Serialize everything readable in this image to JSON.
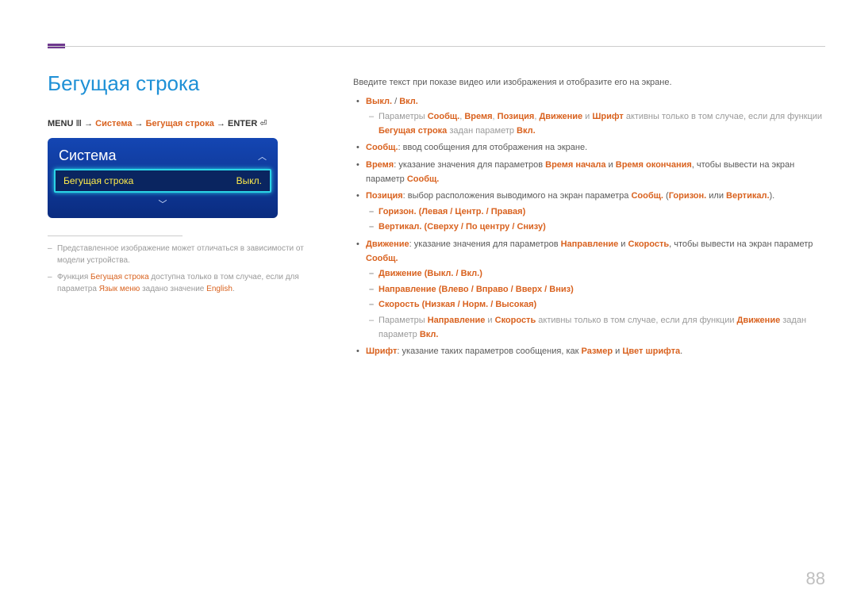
{
  "page_number": "88",
  "title": "Бегущая строка",
  "breadcrumb": {
    "menu": "MENU",
    "menu_icon": "Ⅲ",
    "arrow": "→",
    "p1": "Система",
    "p2": "Бегущая строка",
    "enter": "ENTER",
    "enter_icon": "⏎"
  },
  "osd": {
    "title": "Система",
    "up": "︿",
    "down": "﹀",
    "row_label": "Бегущая строка",
    "row_value": "Выкл."
  },
  "left_notes": {
    "n1_a": "Представленное изображение может отличаться в зависимости от модели устройства.",
    "n2_a": "Функция ",
    "n2_b": "Бегущая строка",
    "n2_c": " доступна только в том случае, если для параметра ",
    "n2_d": "Язык меню",
    "n2_e": " задано значение ",
    "n2_f": "English",
    "n2_g": "."
  },
  "right": {
    "intro": "Введите текст при показе видео или изображения и отобразите его на экране.",
    "b1_off": "Выкл.",
    "b1_sep": " / ",
    "b1_on": "Вкл.",
    "b1_sub_a": "Параметры ",
    "b1_sub_msg": "Сообщ.",
    "b1_sub_comma": ", ",
    "b1_sub_time": "Время",
    "b1_sub_pos": "Позиция",
    "b1_sub_mov": "Движение",
    "b1_sub_and": " и ",
    "b1_sub_font": "Шрифт",
    "b1_sub_b": " активны только в том случае, если для функции ",
    "b1_sub_ticker": "Бегущая строка",
    "b1_sub_c": " задан параметр ",
    "b1_sub_on": "Вкл.",
    "b2_label": "Сообщ.",
    "b2_text": ": ввод сообщения для отображения на экране.",
    "b3_label": "Время",
    "b3_text_a": ": указание значения для параметров ",
    "b3_start": "Время начала",
    "b3_text_b": " и ",
    "b3_end": "Время окончания",
    "b3_text_c": ", чтобы вывести на экран параметр ",
    "b3_msg": "Сообщ.",
    "b4_label": "Позиция",
    "b4_text_a": ": выбор расположения выводимого на экран параметра ",
    "b4_msg": "Сообщ.",
    "b4_text_b": " (",
    "b4_hor": "Горизон.",
    "b4_text_c": " или ",
    "b4_ver": "Вертикал.",
    "b4_text_d": ").",
    "b4_s1_a": "Горизон.",
    "b4_s1_b": " (",
    "b4_s1_c": "Левая",
    "b4_s1_d": " / ",
    "b4_s1_e": "Центр.",
    "b4_s1_f": " / ",
    "b4_s1_g": "Правая",
    "b4_s1_h": ")",
    "b4_s2_a": "Вертикал.",
    "b4_s2_b": " (",
    "b4_s2_c": "Сверху",
    "b4_s2_d": " / ",
    "b4_s2_e": "По центру",
    "b4_s2_f": " / ",
    "b4_s2_g": "Снизу",
    "b4_s2_h": ")",
    "b5_label": "Движение",
    "b5_text_a": ": указание значения для параметров ",
    "b5_dir": "Направление",
    "b5_text_b": " и ",
    "b5_speed": "Скорость",
    "b5_text_c": ", чтобы вывести на экран параметр ",
    "b5_msg": "Сообщ.",
    "b5_s1_a": "Движение",
    "b5_s1_b": " (",
    "b5_s1_c": "Выкл.",
    "b5_s1_d": " / ",
    "b5_s1_e": "Вкл.",
    "b5_s1_f": ")",
    "b5_s2_a": "Направление",
    "b5_s2_b": " (",
    "b5_s2_c": "Влево",
    "b5_s2_d": " / ",
    "b5_s2_e": "Вправо",
    "b5_s2_f": " / ",
    "b5_s2_g": "Вверх",
    "b5_s2_h": " / ",
    "b5_s2_i": "Вниз",
    "b5_s2_j": ")",
    "b5_s3_a": "Скорость",
    "b5_s3_b": " (",
    "b5_s3_c": "Низкая",
    "b5_s3_d": " / ",
    "b5_s3_e": "Норм.",
    "b5_s3_f": " / ",
    "b5_s3_g": "Высокая",
    "b5_s3_h": ")",
    "b5_s4_a": "Параметры ",
    "b5_s4_dir": "Направление",
    "b5_s4_b": " и ",
    "b5_s4_speed": "Скорость",
    "b5_s4_c": " активны только в том случае, если для функции ",
    "b5_s4_mov": "Движение",
    "b5_s4_d": " задан параметр ",
    "b5_s4_on": "Вкл.",
    "b6_label": "Шрифт",
    "b6_text_a": ": указание таких параметров сообщения, как ",
    "b6_size": "Размер",
    "b6_text_b": " и ",
    "b6_color": "Цвет шрифта",
    "b6_text_c": "."
  }
}
